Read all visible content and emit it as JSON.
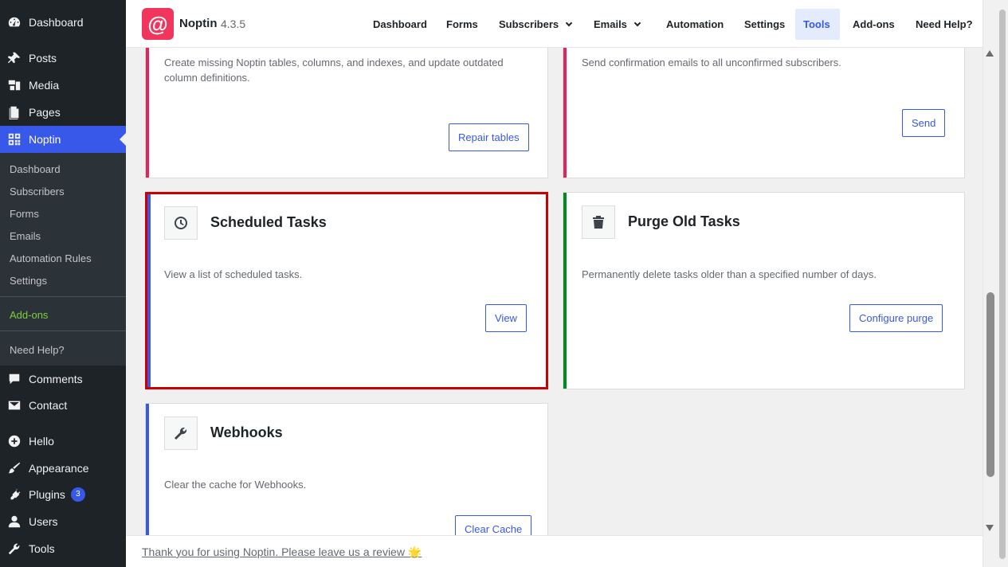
{
  "sidebar": {
    "top_items": [
      {
        "label": "Dashboard",
        "icon": "dashboard-icon"
      },
      {
        "label": "Posts",
        "icon": "pin-icon"
      },
      {
        "label": "Media",
        "icon": "media-icon"
      },
      {
        "label": "Pages",
        "icon": "pages-icon"
      },
      {
        "label": "Noptin",
        "icon": "grid-icon"
      }
    ],
    "submenu": [
      "Dashboard",
      "Subscribers",
      "Forms",
      "Emails",
      "Automation Rules",
      "Settings"
    ],
    "addons": "Add-ons",
    "need_help": "Need Help?",
    "bottom_items": [
      {
        "label": "Comments",
        "icon": "comments-icon"
      },
      {
        "label": "Contact",
        "icon": "mail-icon"
      },
      {
        "label": "Hello",
        "icon": "plus-circle-icon"
      },
      {
        "label": "Appearance",
        "icon": "paintbrush-icon"
      },
      {
        "label": "Plugins",
        "icon": "plugin-icon",
        "badge": "3"
      },
      {
        "label": "Users",
        "icon": "users-icon"
      },
      {
        "label": "Tools",
        "icon": "wrench-icon"
      }
    ]
  },
  "header": {
    "brand": "Noptin",
    "version": "4.3.5",
    "nav": [
      "Dashboard",
      "Forms",
      "Subscribers",
      "Emails",
      "Automation",
      "Settings",
      "Tools",
      "Add-ons",
      "Need Help?"
    ],
    "active_nav": "Tools"
  },
  "cards": {
    "repair": {
      "desc": "Create missing Noptin tables, columns, and indexes, and update outdated column definitions.",
      "button": "Repair tables",
      "accent": "#e0245e"
    },
    "send": {
      "desc": "Send confirmation emails to all unconfirmed subscribers.",
      "button": "Send",
      "accent": "#e0245e"
    },
    "scheduled": {
      "title": "Scheduled Tasks",
      "desc": "View a list of scheduled tasks.",
      "button": "View",
      "accent": "#3858e9",
      "icon": "clock-icon"
    },
    "purge": {
      "title": "Purge Old Tasks",
      "desc": "Permanently delete tasks older than a specified number of days.",
      "button": "Configure purge",
      "accent": "#008a20",
      "icon": "trash-icon"
    },
    "webhooks": {
      "title": "Webhooks",
      "desc": "Clear the cache for Webhooks.",
      "button": "Clear Cache",
      "accent": "#3858e9",
      "icon": "wrench-icon"
    }
  },
  "footer": {
    "text": "Thank you for using Noptin. Please leave us a review 🌟"
  },
  "colors": {
    "sidebar": "#1d2327",
    "active": "#3858e9",
    "brand": "#f0365c",
    "highlight": "#cc0000"
  }
}
